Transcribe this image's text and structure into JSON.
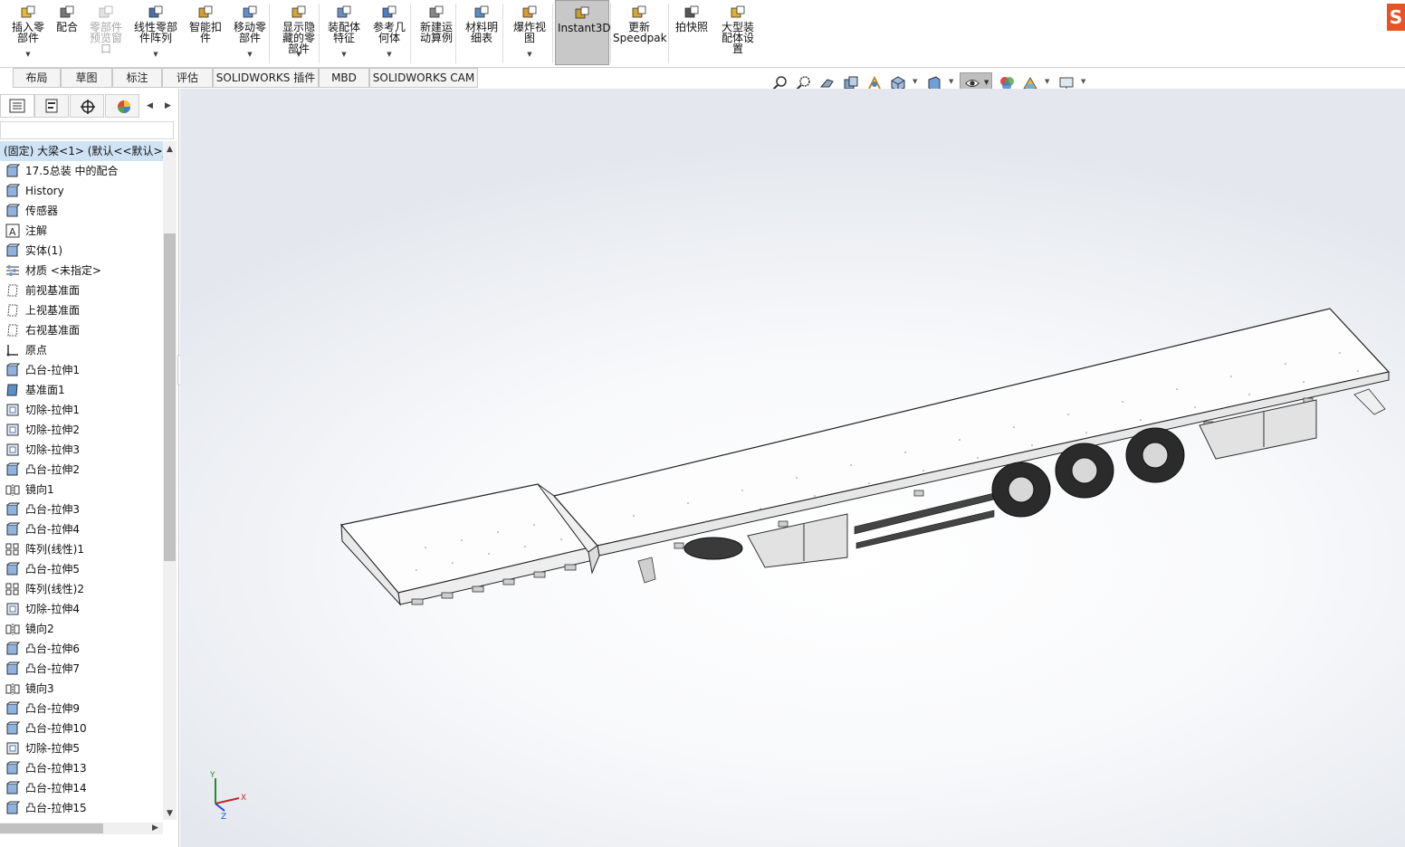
{
  "ribbon": {
    "buttons": [
      {
        "id": "insert-part",
        "label": "插入零\n部件",
        "icon": "insert-component-icon"
      },
      {
        "id": "mate",
        "label": "配合",
        "icon": "mate-icon"
      },
      {
        "id": "component-preview",
        "label": "零部件\n预览窗\n口",
        "icon": "preview-window-icon",
        "disabled": true
      },
      {
        "id": "linear-pattern",
        "label": "线性零部\n件阵列",
        "icon": "linear-pattern-icon"
      },
      {
        "id": "smart-fastener",
        "label": "智能扣\n件",
        "icon": "smart-fastener-icon"
      },
      {
        "id": "move-component",
        "label": "移动零\n部件",
        "icon": "move-component-icon"
      },
      {
        "id": "show-hidden",
        "label": "显示隐\n藏的零\n部件",
        "icon": "show-hidden-icon"
      },
      {
        "id": "assembly-features",
        "label": "装配体\n特征",
        "icon": "assembly-feature-icon"
      },
      {
        "id": "reference-geometry",
        "label": "参考几\n何体",
        "icon": "reference-geometry-icon"
      },
      {
        "id": "new-motion-study",
        "label": "新建运\n动算例",
        "icon": "motion-study-icon"
      },
      {
        "id": "bom",
        "label": "材料明\n细表",
        "icon": "bom-icon"
      },
      {
        "id": "exploded-view",
        "label": "爆炸视\n图",
        "icon": "exploded-view-icon"
      },
      {
        "id": "instant3d",
        "label": "Instant3D",
        "icon": "instant3d-icon",
        "active": true
      },
      {
        "id": "update-speedpak",
        "label": "更新\nSpeedpak",
        "icon": "speedpak-icon"
      },
      {
        "id": "snapshot",
        "label": "拍快照",
        "icon": "camera-icon"
      },
      {
        "id": "large-assembly",
        "label": "大型装\n配体设\n置",
        "icon": "large-assembly-icon"
      }
    ]
  },
  "tabs": [
    "布局",
    "草图",
    "标注",
    "评估",
    "SOLIDWORKS 插件",
    "MBD",
    "SOLIDWORKS CAM"
  ],
  "tree": {
    "root": "(固定) 大梁<1> (默认<<默认>_",
    "items": [
      {
        "label": "17.5总装 中的配合",
        "icon": "mates-folder-icon"
      },
      {
        "label": "History",
        "icon": "history-icon"
      },
      {
        "label": "传感器",
        "icon": "sensor-icon"
      },
      {
        "label": "注解",
        "icon": "annotation-icon"
      },
      {
        "label": "实体(1)",
        "icon": "solid-bodies-icon"
      },
      {
        "label": "材质 <未指定>",
        "icon": "material-icon"
      },
      {
        "label": "前视基准面",
        "icon": "plane-icon"
      },
      {
        "label": "上视基准面",
        "icon": "plane-icon"
      },
      {
        "label": "右视基准面",
        "icon": "plane-icon"
      },
      {
        "label": "原点",
        "icon": "origin-icon"
      },
      {
        "label": "凸台-拉伸1",
        "icon": "boss-extrude-icon"
      },
      {
        "label": "基准面1",
        "icon": "plane-feature-icon"
      },
      {
        "label": "切除-拉伸1",
        "icon": "cut-extrude-icon"
      },
      {
        "label": "切除-拉伸2",
        "icon": "cut-extrude-icon"
      },
      {
        "label": "切除-拉伸3",
        "icon": "cut-extrude-icon"
      },
      {
        "label": "凸台-拉伸2",
        "icon": "boss-extrude-icon"
      },
      {
        "label": "镜向1",
        "icon": "mirror-icon"
      },
      {
        "label": "凸台-拉伸3",
        "icon": "boss-extrude-icon"
      },
      {
        "label": "凸台-拉伸4",
        "icon": "boss-extrude-icon"
      },
      {
        "label": "阵列(线性)1",
        "icon": "linear-pattern-icon"
      },
      {
        "label": "凸台-拉伸5",
        "icon": "boss-extrude-icon"
      },
      {
        "label": "阵列(线性)2",
        "icon": "linear-pattern-icon"
      },
      {
        "label": "切除-拉伸4",
        "icon": "cut-extrude-icon"
      },
      {
        "label": "镜向2",
        "icon": "mirror-icon"
      },
      {
        "label": "凸台-拉伸6",
        "icon": "boss-extrude-icon"
      },
      {
        "label": "凸台-拉伸7",
        "icon": "boss-extrude-icon"
      },
      {
        "label": "镜向3",
        "icon": "mirror-icon"
      },
      {
        "label": "凸台-拉伸9",
        "icon": "boss-extrude-icon"
      },
      {
        "label": "凸台-拉伸10",
        "icon": "boss-extrude-icon"
      },
      {
        "label": "切除-拉伸5",
        "icon": "cut-extrude-icon"
      },
      {
        "label": "凸台-拉伸13",
        "icon": "boss-extrude-icon"
      },
      {
        "label": "凸台-拉伸14",
        "icon": "boss-extrude-icon"
      },
      {
        "label": "凸台-拉伸15",
        "icon": "boss-extrude-icon"
      }
    ]
  },
  "triad": {
    "x": "X",
    "y": "Y",
    "z": "Z"
  },
  "colors": {
    "accent": "#e85324",
    "active_tab": "#c8c8c8",
    "tree_selected": "#cfe3f5"
  }
}
